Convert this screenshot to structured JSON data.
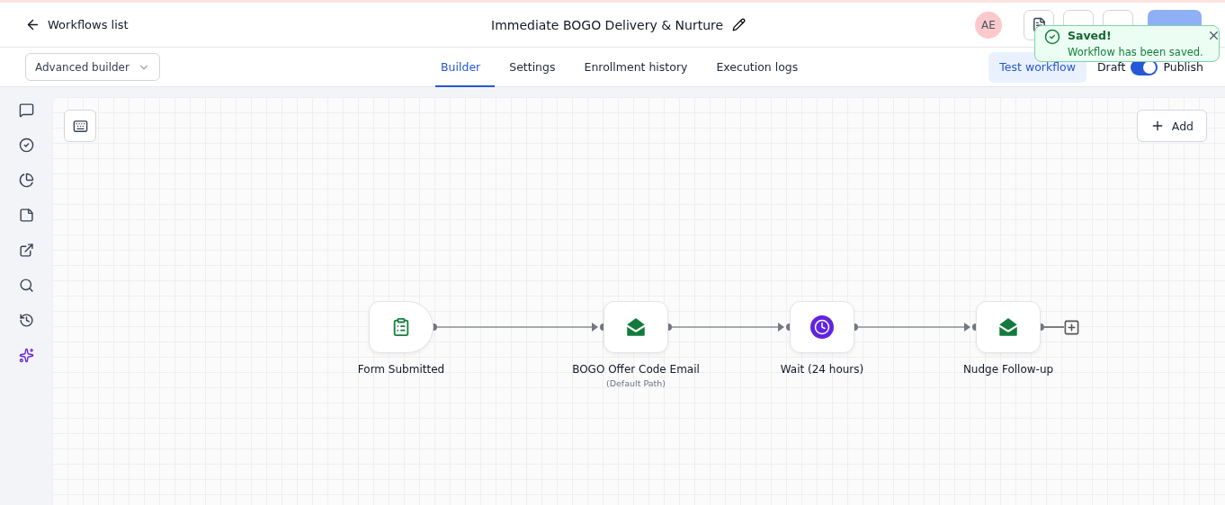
{
  "header": {
    "back_label": "Workflows list",
    "title": "Immediate BOGO Delivery & Nurture",
    "avatar": "AE"
  },
  "builder_select": {
    "value": "Advanced builder"
  },
  "tabs": [
    {
      "label": "Builder",
      "selected": true
    },
    {
      "label": "Settings",
      "selected": false
    },
    {
      "label": "Enrollment history",
      "selected": false
    },
    {
      "label": "Execution logs",
      "selected": false
    }
  ],
  "test_button": "Test workflow",
  "status_toggle": {
    "off_label": "Draft",
    "on_label": "Publish",
    "on": true
  },
  "canvas": {
    "add_button": "Add"
  },
  "nodes": [
    {
      "kind": "trigger",
      "label": "Form Submitted"
    },
    {
      "kind": "email",
      "label": "BOGO Offer Code Email",
      "sublabel": "(Default Path)"
    },
    {
      "kind": "wait",
      "label": "Wait (24 hours)"
    },
    {
      "kind": "email",
      "label": "Nudge Follow-up"
    }
  ],
  "toast": {
    "title": "Saved!",
    "message": "Workflow has been saved."
  }
}
